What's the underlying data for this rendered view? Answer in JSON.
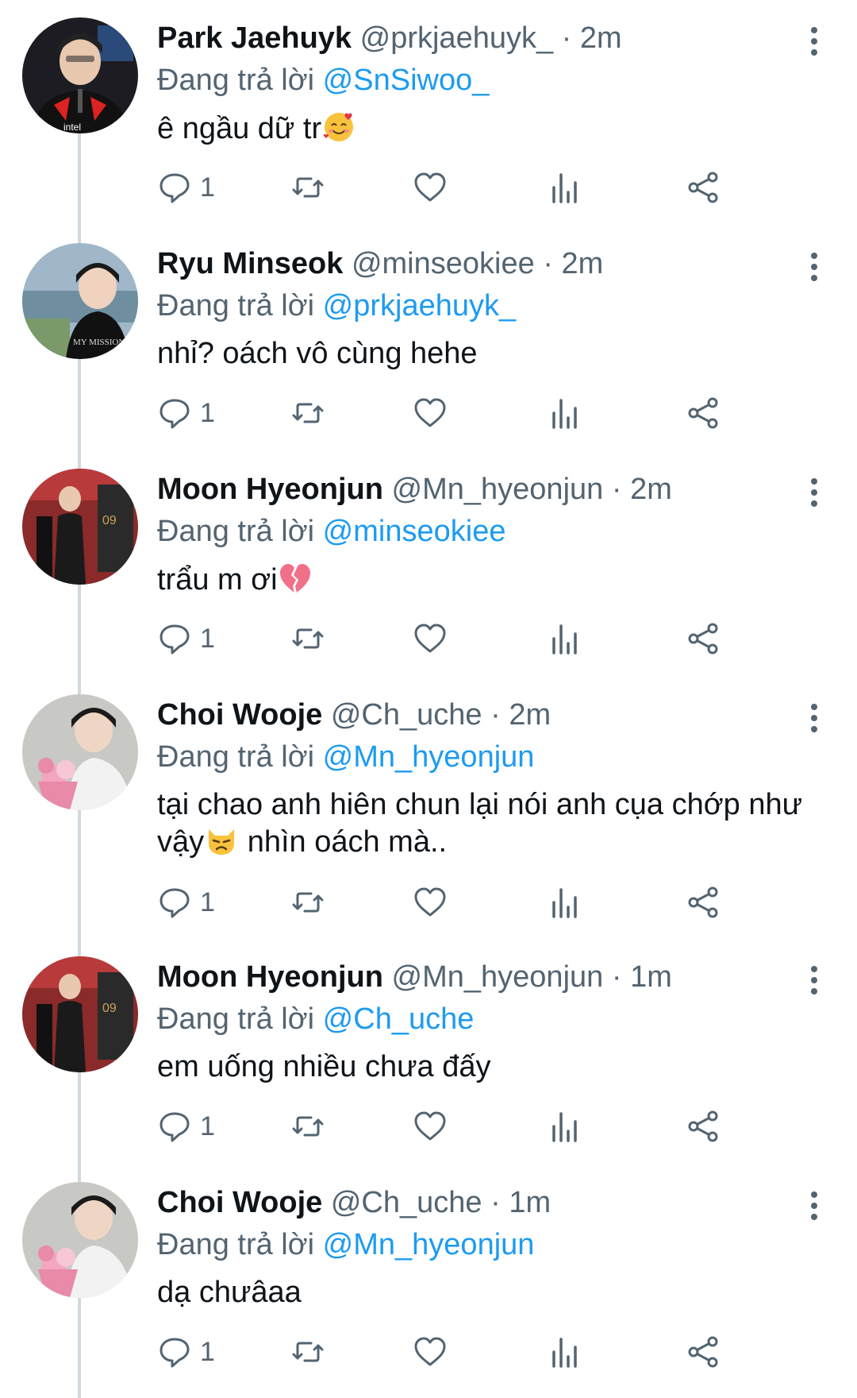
{
  "reply_prefix": "Đang trả lời",
  "tweets": [
    {
      "display_name": "Park Jaehuyk",
      "handle": "@prkjaehuyk_",
      "separator": "·",
      "time": "2m",
      "reply_to": "@SnSiwoo_",
      "text": "ê ngầu dữ tr",
      "emoji": "smiling-face-with-hearts",
      "reply_count": "1"
    },
    {
      "display_name": "Ryu Minseok",
      "handle": "@minseokiee",
      "separator": "·",
      "time": "2m",
      "reply_to": "@prkjaehuyk_",
      "text": "nhỉ? oách vô cùng hehe",
      "reply_count": "1"
    },
    {
      "display_name": "Moon Hyeonjun",
      "handle": "@Mn_hyeonjun",
      "separator": "·",
      "time": "2m",
      "reply_to": "@minseokiee",
      "text": "trẩu m ơi",
      "emoji": "broken-heart",
      "reply_count": "1"
    },
    {
      "display_name": "Choi Wooje",
      "handle": "@Ch_uche",
      "separator": "·",
      "time": "2m",
      "reply_to": "@Mn_hyeonjun",
      "text_line1": "tại chao anh hiên chun lại nói anh cụa chớp như",
      "text_line2_a": "vậy",
      "text_line2_b": " nhìn oách mà..",
      "emoji": "pouting-cat",
      "reply_count": "1"
    },
    {
      "display_name": "Moon Hyeonjun",
      "handle": "@Mn_hyeonjun",
      "separator": "·",
      "time": "1m",
      "reply_to": "@Ch_uche",
      "text": "em uống nhiều chưa đấy",
      "reply_count": "1"
    },
    {
      "display_name": "Choi Wooje",
      "handle": "@Ch_uche",
      "separator": "·",
      "time": "1m",
      "reply_to": "@Mn_hyeonjun",
      "text": "dạ chưâaa",
      "reply_count": "1"
    }
  ],
  "colors": {
    "link": "#1d9bf0",
    "secondary_text": "#536471",
    "primary_text": "#0f1419",
    "thread_line": "#cfd9de"
  }
}
